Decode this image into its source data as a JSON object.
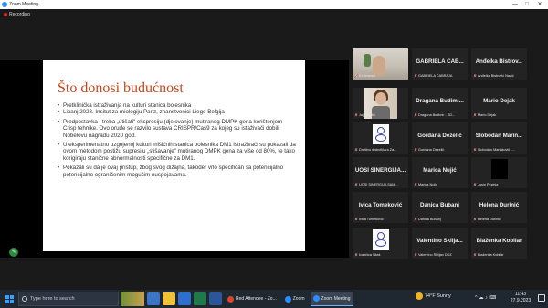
{
  "window": {
    "title": "Zoom Meeting",
    "recording_label": "Recording",
    "minimize_glyph": "—",
    "maximize_glyph": "□",
    "close_glyph": "✕"
  },
  "slide": {
    "title": "Što donosi budućnost",
    "bullets": [
      "Pretklinička istraživanja na kulturi stanica bolesnika",
      "Lipanj 2023. Insitut za miologiju Pariz, znanstvenici Liege Belgija",
      "Predpostavka : treba „utišati\" ekspresiju (djelovanje) mutiranog DMPK gena korištenjem Crisp tehnike. Ovo oruđe se razvilo sustava CRISPR/Cas9 za kojeg su istaživači dobili Nobelovu nagradu 2020 god.",
      "U eksperimenatno uzgojenoj kulturi mišićnih stanica bolesnika DM1 istraživači su pokazali da ovom metodom postižu supresiju „stišavanje\" mutiranog DMPK gena za više od 80%, te tako korigiraju stanične abnormalnosti specifične za DM1.",
      "Pokazali su da je ovaj pristup, zbog svog dizajna, također vrlo specifičan sa potencijalno potencijalno ograničenim mogućim nuspojavama."
    ]
  },
  "participants": [
    {
      "name": "",
      "caption": "Dr. Vrana4",
      "kind": "room"
    },
    {
      "name": "GABRIELA ČAB...",
      "caption": "GABRIELA ČABRAJA",
      "kind": "name"
    },
    {
      "name": "Anđelka Bistrov...",
      "caption": "Anđelka Bistrović Nazić",
      "kind": "name"
    },
    {
      "name": "",
      "caption": "Jajna Lulić",
      "kind": "jajna"
    },
    {
      "name": "Dragana Budimi...",
      "caption": "Dragana Budimir - SD...",
      "kind": "name"
    },
    {
      "name": "Mario Dejak",
      "caption": "Mario Dejak",
      "kind": "name"
    },
    {
      "name": "",
      "caption": "Društvo distrofičara Za...",
      "kind": "logo"
    },
    {
      "name": "Gordana Dezelić",
      "caption": "Gordana Dezelić",
      "kind": "name"
    },
    {
      "name": "Slobodan Marin...",
      "caption": "Slobodan Marinković -...",
      "kind": "name"
    },
    {
      "name": "UOSI SINERGIJA...",
      "caption": "UOSI SINERGIJA SAM...",
      "kind": "name"
    },
    {
      "name": "Marica Nujić",
      "caption": "Marica Nujić",
      "kind": "name"
    },
    {
      "name": "",
      "caption": "Josip Pezinja",
      "kind": "black"
    },
    {
      "name": "Ivica Tomeković",
      "caption": "Ivica Tomeković",
      "kind": "name"
    },
    {
      "name": "Danica Bubanj",
      "caption": "Danica Bubanj",
      "kind": "name"
    },
    {
      "name": "Helena Đurinić",
      "caption": "Helena Đurinić",
      "kind": "name"
    },
    {
      "name": "",
      "caption": "Ivančica Sitaš",
      "kind": "logo"
    },
    {
      "name": "Valentino Škilja...",
      "caption": "Valentino Škiljan DDZ",
      "kind": "name"
    },
    {
      "name": "Blaženka Kobilar",
      "caption": "Blaženka Kobilar",
      "kind": "name"
    }
  ],
  "taskbar": {
    "search_placeholder": "Type here to search",
    "apps": [
      {
        "label": "Red Attendee - Zo...",
        "color": "#d9472b"
      },
      {
        "label": "Zoom",
        "color": "#2d8cff"
      },
      {
        "label": "Zoom Meeting",
        "color": "#2d8cff"
      }
    ],
    "weather": "74°F  Sunny",
    "time": "11:43",
    "date": "27.9.2023",
    "tray_glyphs": "^ ☁ ♪ ⌨"
  },
  "colors": {
    "active_speaker": "#8fd13a",
    "slide_title": "#c8471a",
    "zoom_blue": "#2d8cff"
  }
}
